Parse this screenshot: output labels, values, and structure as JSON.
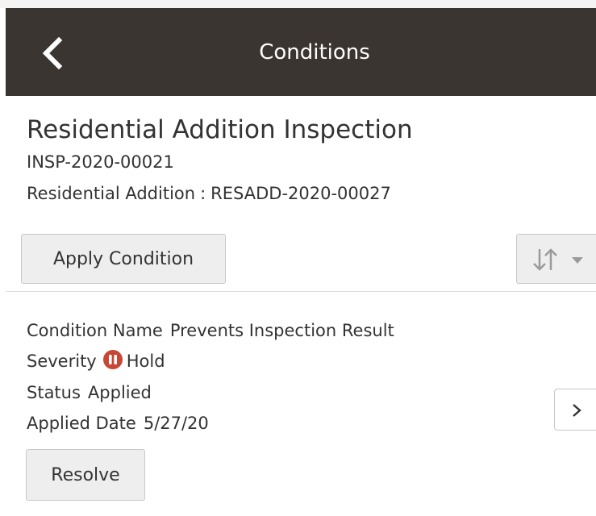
{
  "header": {
    "title": "Conditions",
    "back_icon": "chevron-left-icon"
  },
  "record": {
    "title": "Residential Addition Inspection",
    "id": "INSP-2020-00021",
    "parent_type": "Residential Addition",
    "parent_separator": ":",
    "parent_id": "RESADD-2020-00027"
  },
  "toolbar": {
    "apply_label": "Apply Condition",
    "sort_icon": "sort-arrows-icon",
    "sort_caret_icon": "caret-down-icon"
  },
  "condition": {
    "name_label": "Condition Name",
    "name_value": "Prevents Inspection Result",
    "severity_label": "Severity",
    "severity_icon": "hold-icon",
    "severity_value": "Hold",
    "status_label": "Status",
    "status_value": "Applied",
    "date_label": "Applied Date",
    "date_value": "5/27/20",
    "resolve_label": "Resolve",
    "detail_icon": "chevron-right-icon"
  },
  "colors": {
    "header_bg": "#3a3531",
    "header_text": "#ffffff",
    "hold_icon": "#c74634",
    "button_bg": "#eeeeee"
  }
}
